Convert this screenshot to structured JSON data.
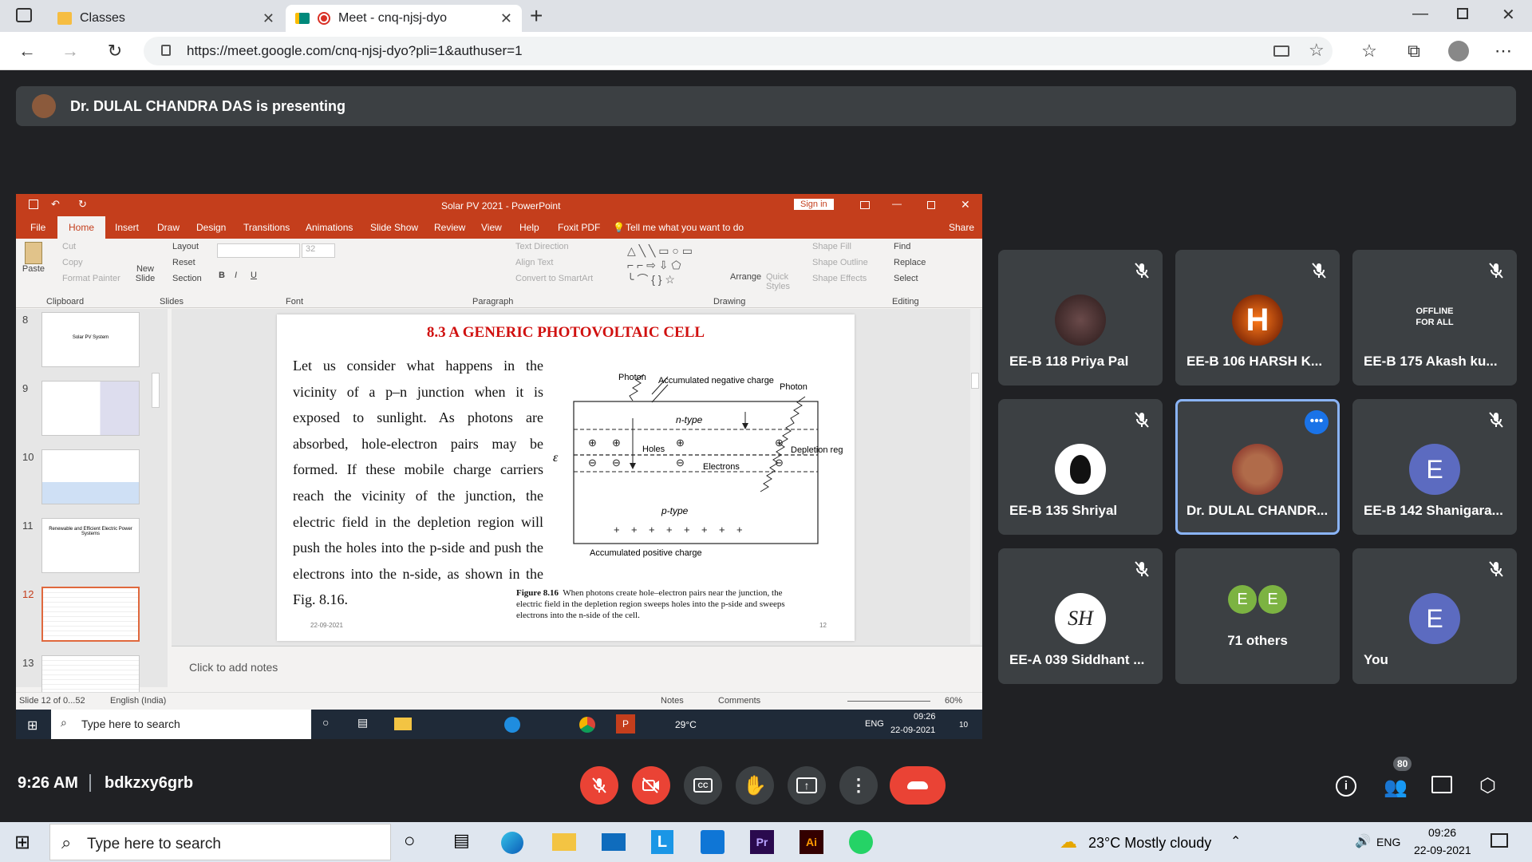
{
  "browser": {
    "tabs": [
      {
        "title": "Classes"
      },
      {
        "title": "Meet - cnq-njsj-dyo"
      }
    ],
    "url": "https://meet.google.com/cnq-njsj-dyo?pli=1&authuser=1"
  },
  "meet": {
    "presenting": "Dr. DULAL CHANDRA DAS is presenting",
    "time": "9:26 AM",
    "code": "bdkzxy6grb",
    "participant_count": "80",
    "tiles": [
      {
        "name": "EE-B 118 Priya Pal",
        "avatar": ""
      },
      {
        "name": "EE-B 106 HARSH K...",
        "avatar": "H"
      },
      {
        "name": "EE-B 175 Akash ku...",
        "offline": "OFFLINE FOR ALL"
      },
      {
        "name": "EE-B 135 Shriyal",
        "avatar": ""
      },
      {
        "name": "Dr. DULAL CHANDR...",
        "avatar": ""
      },
      {
        "name": "EE-B 142 Shanigara...",
        "avatar": "E"
      },
      {
        "name": "EE-A 039 Siddhant ...",
        "avatar": "SH"
      },
      {
        "name": "71 others",
        "avatar": "E"
      },
      {
        "name": "You",
        "avatar": "E"
      }
    ]
  },
  "ppt": {
    "title": "Solar PV 2021  -  PowerPoint",
    "signin": "Sign in",
    "tabs": [
      "File",
      "Home",
      "Insert",
      "Draw",
      "Design",
      "Transitions",
      "Animations",
      "Slide Show",
      "Review",
      "View",
      "Help",
      "Foxit PDF",
      "Tell me what you want to do",
      "Share"
    ],
    "ribbon": {
      "paste": "Paste",
      "cut": "Cut",
      "copy": "Copy",
      "format_painter": "Format Painter",
      "new_slide": "New Slide",
      "layout": "Layout",
      "reset": "Reset",
      "section": "Section",
      "font_size": "32",
      "text_direction": "Text Direction",
      "align_text": "Align Text",
      "convert_smartart": "Convert to SmartArt",
      "arrange": "Arrange",
      "quick_styles": "Quick Styles",
      "shape_fill": "Shape Fill",
      "shape_outline": "Shape Outline",
      "shape_effects": "Shape Effects",
      "find": "Find",
      "replace": "Replace",
      "select": "Select",
      "groups": [
        "Clipboard",
        "Slides",
        "Font",
        "Paragraph",
        "Drawing",
        "Editing"
      ]
    },
    "thumb_nums": [
      "8",
      "9",
      "10",
      "11",
      "12",
      "13"
    ],
    "thumb_texts": [
      "Solar PV System",
      "Renewable and Efficient Electric Power Systems"
    ],
    "notes": "Click to add notes",
    "status": {
      "slide": "Slide 12 of 0...52",
      "lang": "English (India)",
      "notes": "Notes",
      "comments": "Comments",
      "zoom": "60%"
    }
  },
  "slide": {
    "heading": "8.3  A GENERIC PHOTOVOLTAIC CELL",
    "body": "Let us consider what happens in the vicinity of a p–n junction when it is exposed to sunlight. As photons are absorbed, hole-electron pairs may be formed. If these mobile charge carriers reach the vicinity of the junction, the electric field in the depletion region will push the holes into the p-side and push the electrons into the n-side, as shown in the Fig. 8.16.",
    "diagram": {
      "photon1": "Photon",
      "photon2": "Photon",
      "acc_neg": "Accumulated negative charge",
      "n_type": "n-type",
      "holes": "Holes",
      "electrons": "Electrons",
      "depletion": "Depletion region",
      "p_type": "p-type",
      "acc_pos": "Accumulated positive charge",
      "field": "ε"
    },
    "caption_label": "Figure 8.16",
    "caption": "When photons create hole–electron pairs near the junction, the electric field in the depletion region sweeps holes into the p-side and sweeps electrons into the n-side of the cell.",
    "date": "22-09-2021",
    "pagenum": "12"
  },
  "inner_taskbar": {
    "search": "Type here to search",
    "weather": "29°C",
    "lang": "ENG",
    "time": "09:26",
    "date": "22-09-2021",
    "notif": "10"
  },
  "taskbar": {
    "search": "Type here to search",
    "weather": "23°C  Mostly cloudy",
    "lang": "ENG",
    "time": "09:26",
    "date": "22-09-2021"
  },
  "colors": {
    "meet_bg": "#202124",
    "ppt_red": "#c43e1c",
    "end_call": "#ea4335"
  }
}
